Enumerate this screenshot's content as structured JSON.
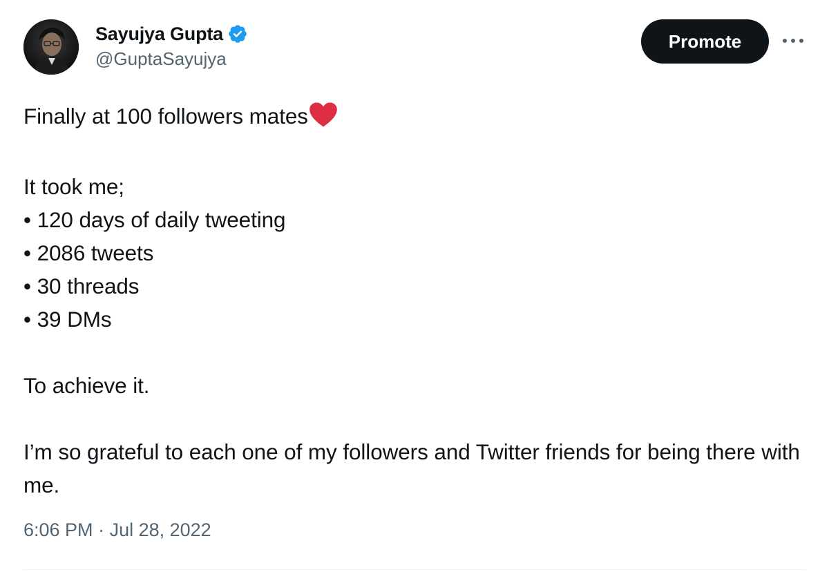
{
  "author": {
    "display_name": "Sayujya Gupta",
    "handle": "@GuptaSayujya",
    "verified": true
  },
  "actions": {
    "promote_label": "Promote",
    "more_icon": "more-horizontal-icon"
  },
  "tweet": {
    "line_1": "Finally at 100 followers mates",
    "line_1_emoji": "red-heart",
    "line_2": "It took me;",
    "bullets": [
      "• 120 days of daily tweeting",
      "• 2086 tweets",
      "• 30 threads",
      "• 39 DMs"
    ],
    "line_3": "To achieve it.",
    "line_4": "I’m so grateful to each one of my followers and Twitter friends for being there with me."
  },
  "meta": {
    "time": "6:06 PM",
    "separator": " · ",
    "date": "Jul 28, 2022"
  },
  "colors": {
    "text_primary": "#0f1419",
    "text_secondary": "#536471",
    "verified_blue": "#1d9bf0",
    "heart_red": "#e0245e",
    "button_dark": "#0f1419"
  }
}
